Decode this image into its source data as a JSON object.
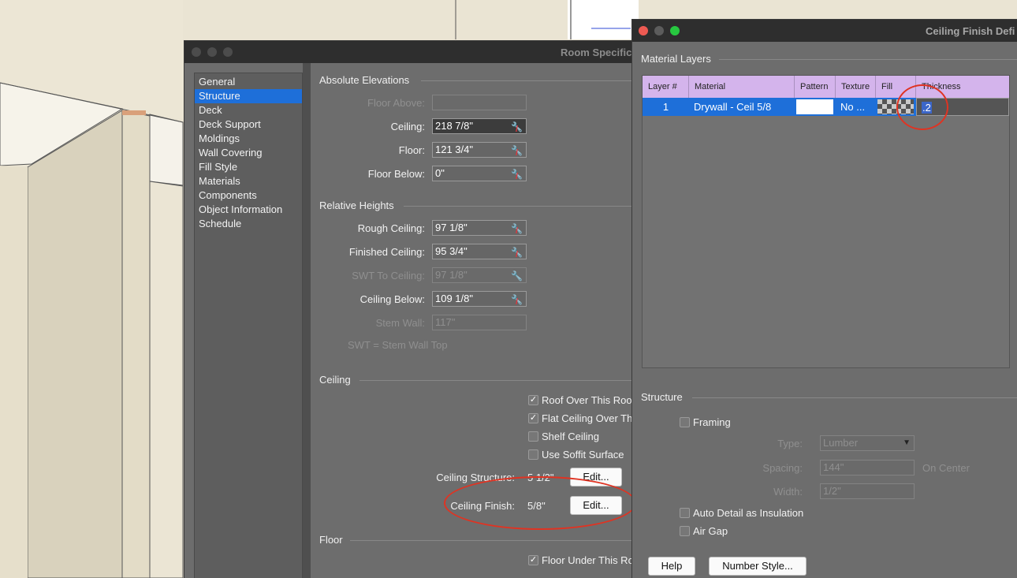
{
  "room_dialog": {
    "title": "Room Specification",
    "nav": [
      "General",
      "Structure",
      "Deck",
      "Deck Support",
      "Moldings",
      "Wall Covering",
      "Fill Style",
      "Materials",
      "Components",
      "Object Information",
      "Schedule"
    ],
    "selected_nav": "Structure",
    "absolute_elevations": {
      "heading": "Absolute Elevations",
      "floor_above": {
        "label": "Floor Above:",
        "value": ""
      },
      "ceiling": {
        "label": "Ceiling:",
        "value": "218 7/8\""
      },
      "floor": {
        "label": "Floor:",
        "value": "121 3/4\""
      },
      "floor_below": {
        "label": "Floor Below:",
        "value": "0\""
      }
    },
    "relative_heights": {
      "heading": "Relative Heights",
      "rough_ceiling": {
        "label": "Rough Ceiling:",
        "value": "97 1/8\""
      },
      "finished_ceiling": {
        "label": "Finished Ceiling:",
        "value": "95 3/4\""
      },
      "swt_to_ceiling": {
        "label": "SWT To Ceiling:",
        "value": "97 1/8\""
      },
      "ceiling_below": {
        "label": "Ceiling Below:",
        "value": "109 1/8\""
      },
      "stem_wall": {
        "label": "Stem Wall:",
        "value": "117\""
      },
      "note": "SWT = Stem Wall Top"
    },
    "ceiling": {
      "heading": "Ceiling",
      "checkboxes": [
        {
          "label": "Roof Over This Roo",
          "checked": true
        },
        {
          "label": "Flat Ceiling Over Th",
          "checked": true
        },
        {
          "label": "Shelf Ceiling",
          "checked": false
        },
        {
          "label": "Use Soffit Surface",
          "checked": false
        }
      ],
      "structure": {
        "label": "Ceiling Structure:",
        "value": "5 1/2\"",
        "button": "Edit..."
      },
      "finish": {
        "label": "Ceiling Finish:",
        "value": "5/8\"",
        "button": "Edit..."
      }
    },
    "floor": {
      "heading": "Floor",
      "checkboxes": [
        {
          "label": "Floor Under This Ro",
          "checked": true
        }
      ]
    }
  },
  "cf_dialog": {
    "title": "Ceiling Finish Defi",
    "material_layers": {
      "heading": "Material Layers",
      "columns": [
        "Layer #",
        "Material",
        "Pattern",
        "Texture",
        "Fill",
        "Thickness"
      ],
      "rows": [
        {
          "layer": "1",
          "material": "Drywall - Ceil 5/8",
          "pattern": "",
          "texture": "No ...",
          "fill": "",
          "thickness": ".2"
        }
      ]
    },
    "structure": {
      "heading": "Structure",
      "framing": {
        "label": "Framing",
        "checked": false
      },
      "type": {
        "label": "Type:",
        "value": "Lumber"
      },
      "spacing": {
        "label": "Spacing:",
        "value": "144\"",
        "suffix": "On Center"
      },
      "width": {
        "label": "Width:",
        "value": "1/2\""
      },
      "auto_detail": {
        "label": "Auto Detail as Insulation",
        "checked": false
      },
      "air_gap": {
        "label": "Air Gap",
        "checked": false
      }
    },
    "buttons": {
      "help": "Help",
      "number_style": "Number Style..."
    }
  },
  "colors": {
    "selection_blue": "#1e6fd9",
    "table_header": "#d4b4ec",
    "annotation_red": "#e03322",
    "dialog_bg": "#6d6d6d",
    "scene_bg": "#e9e3d2"
  }
}
